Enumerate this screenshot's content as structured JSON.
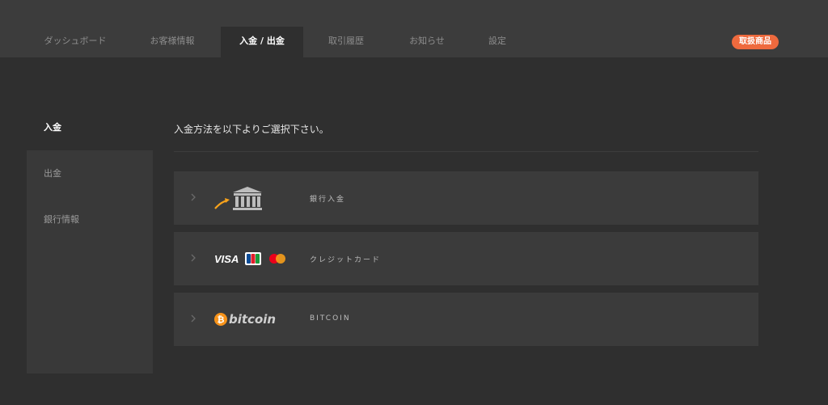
{
  "nav": {
    "tabs": [
      {
        "label": "ダッシュボード"
      },
      {
        "label": "お客様情報"
      },
      {
        "label": "入金 / 出金"
      },
      {
        "label": "取引履歴"
      },
      {
        "label": "お知らせ"
      },
      {
        "label": "設定"
      }
    ],
    "badge": "取扱商品"
  },
  "sidebar": {
    "items": [
      {
        "label": "入金"
      },
      {
        "label": "出金"
      },
      {
        "label": "銀行情報"
      }
    ]
  },
  "main": {
    "heading": "入金方法を以下よりご選択下さい。",
    "methods": [
      {
        "label": "銀行入金",
        "icon": "bank-icon"
      },
      {
        "label": "クレジットカード",
        "logos": [
          "VISA",
          "JCB",
          "mastercard"
        ]
      },
      {
        "label": "BITCOIN",
        "logo_text": "bitcoin",
        "icon": "bitcoin-icon"
      }
    ]
  },
  "colors": {
    "accent": "#ee6a3e",
    "bitcoin": "#f7931a"
  }
}
